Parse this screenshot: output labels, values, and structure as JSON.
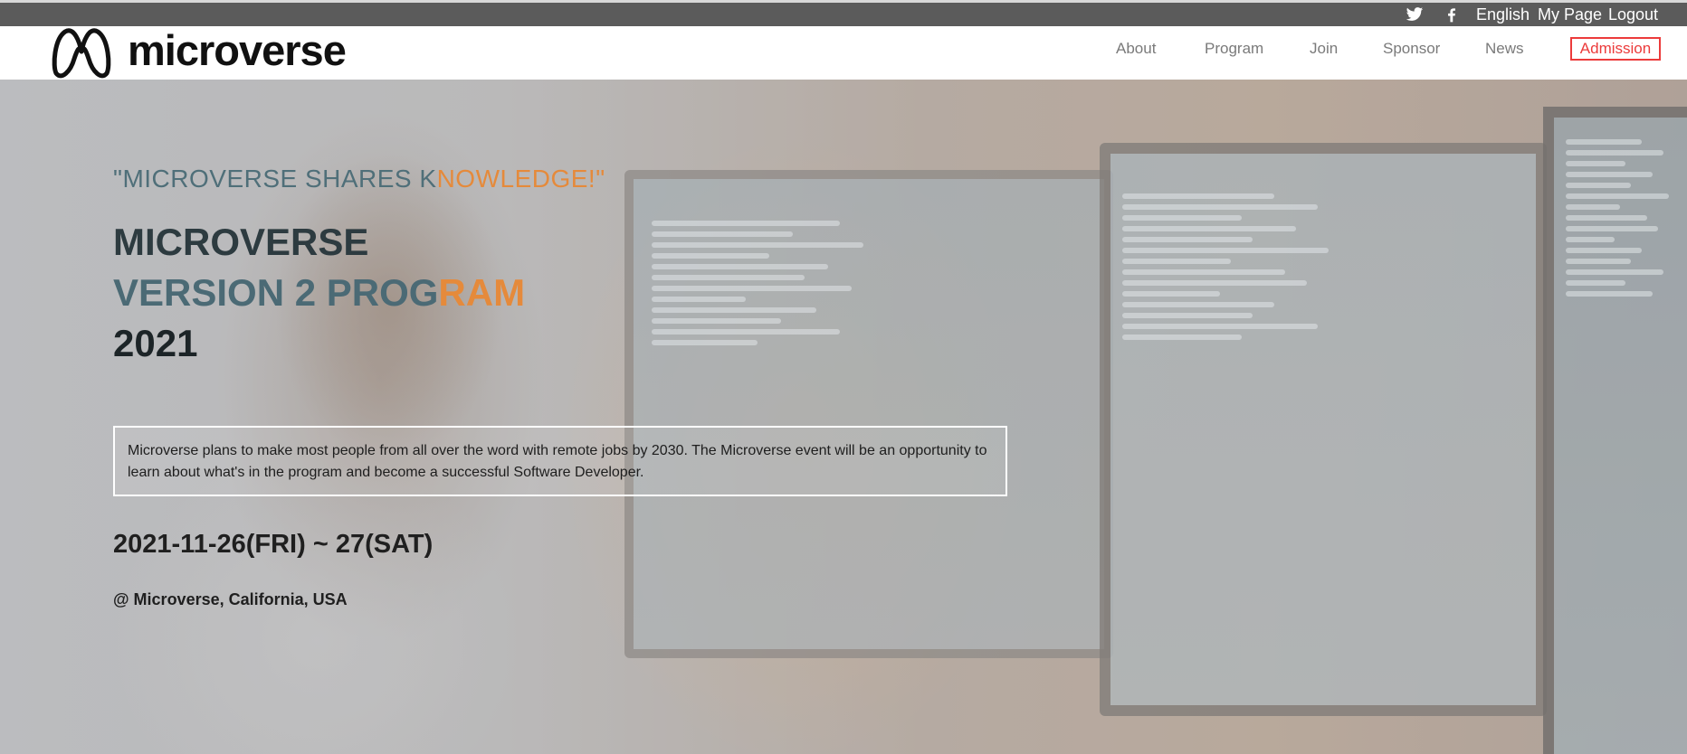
{
  "topbar": {
    "language": "English",
    "my_page": "My Page",
    "logout": "Logout",
    "icons": [
      "twitter-icon",
      "facebook-icon"
    ]
  },
  "header": {
    "logo_text": "microverse",
    "nav": {
      "about": "About",
      "program": "Program",
      "join": "Join",
      "sponsor": "Sponsor",
      "news": "News",
      "admission": "Admission"
    }
  },
  "hero": {
    "tagline_main": "\"MICROVERSE SHARES K",
    "tagline_highlight": "NOWLEDGE!\"",
    "title_line1": "MICROVERSE",
    "title_line2_main": "VERSION 2 PROG",
    "title_line2_highlight": "RAM",
    "title_line3": "2021",
    "description": "Microverse plans to make most people from all over the word with remote jobs by 2030. The Microverse event will be an opportunity to learn about what's in the program and become a successful Software Developer.",
    "date": "2021-11-26(FRI) ~ 27(SAT)",
    "location": "@ Microverse, California, USA"
  },
  "colors": {
    "topbar_bg": "#5b5b5b",
    "accent_orange": "#e58a3b",
    "accent_teal": "#4f6f79",
    "admission_red": "#ec3b3b"
  }
}
